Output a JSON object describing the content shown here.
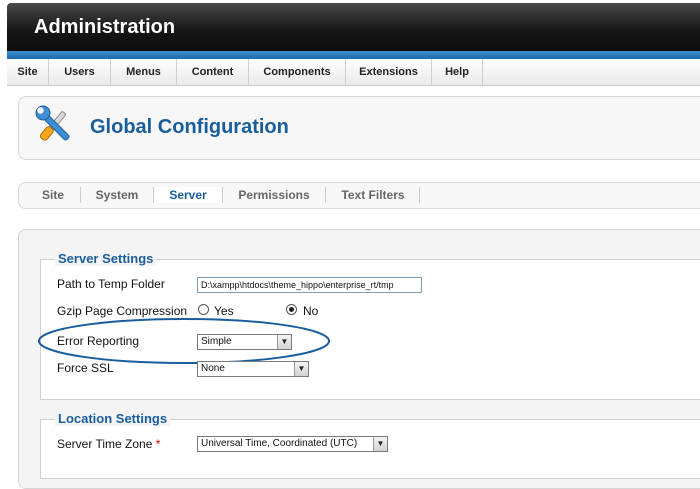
{
  "header": {
    "title": "Administration"
  },
  "menu": {
    "items": [
      {
        "label": "Site"
      },
      {
        "label": "Users"
      },
      {
        "label": "Menus"
      },
      {
        "label": "Content"
      },
      {
        "label": "Components"
      },
      {
        "label": "Extensions"
      },
      {
        "label": "Help"
      }
    ]
  },
  "page": {
    "title": "Global Configuration",
    "icon": "tools-icon"
  },
  "tabs": {
    "items": [
      {
        "label": "Site"
      },
      {
        "label": "System"
      },
      {
        "label": "Server",
        "active": true
      },
      {
        "label": "Permissions"
      },
      {
        "label": "Text Filters"
      }
    ]
  },
  "server_settings": {
    "legend": "Server Settings",
    "temp_folder": {
      "label": "Path to Temp Folder",
      "value": "D:\\xampp\\htdocs\\theme_hippo\\enterprise_rt/tmp"
    },
    "gzip": {
      "label": "Gzip Page Compression",
      "yes_label": "Yes",
      "no_label": "No",
      "selected": "No"
    },
    "error_reporting": {
      "label": "Error Reporting",
      "value": "Simple"
    },
    "force_ssl": {
      "label": "Force SSL",
      "value": "None"
    }
  },
  "location_settings": {
    "legend": "Location Settings",
    "time_zone": {
      "label": "Server Time Zone",
      "required_mark": "*",
      "value": "Universal Time, Coordinated (UTC)"
    }
  },
  "colors": {
    "accent": "#1a5d9c",
    "header_bg": "#161616",
    "stripe": "#2a7fc5",
    "highlight_ellipse": "#1a5d9c",
    "required": "#cc0000"
  }
}
